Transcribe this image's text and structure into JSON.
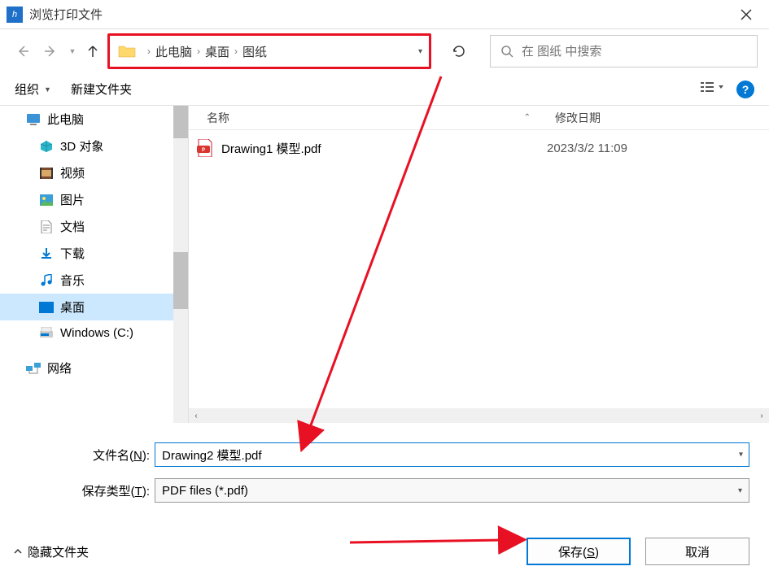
{
  "titlebar": {
    "title": "浏览打印文件"
  },
  "breadcrumb": {
    "items": [
      "此电脑",
      "桌面",
      "图纸"
    ]
  },
  "search": {
    "placeholder": "在 图纸 中搜索"
  },
  "toolbar": {
    "organize": "组织",
    "new_folder": "新建文件夹"
  },
  "sidebar": {
    "root": "此电脑",
    "items": [
      {
        "label": "3D 对象",
        "icon": "cube"
      },
      {
        "label": "视频",
        "icon": "video"
      },
      {
        "label": "图片",
        "icon": "picture"
      },
      {
        "label": "文档",
        "icon": "document"
      },
      {
        "label": "下载",
        "icon": "download"
      },
      {
        "label": "音乐",
        "icon": "music"
      },
      {
        "label": "桌面",
        "icon": "desktop",
        "selected": true
      },
      {
        "label": "Windows (C:)",
        "icon": "drive"
      }
    ],
    "network": "网络"
  },
  "columns": {
    "name": "名称",
    "date": "修改日期"
  },
  "files": [
    {
      "name": "Drawing1 模型.pdf",
      "date": "2023/3/2 11:09"
    }
  ],
  "form": {
    "filename_label": "文件名(N):",
    "filename_value": "Drawing2 模型.pdf",
    "filetype_label": "保存类型(T):",
    "filetype_value": "PDF files (*.pdf)"
  },
  "footer": {
    "hide_folders": "隐藏文件夹",
    "save": "保存(S)",
    "cancel": "取消"
  }
}
